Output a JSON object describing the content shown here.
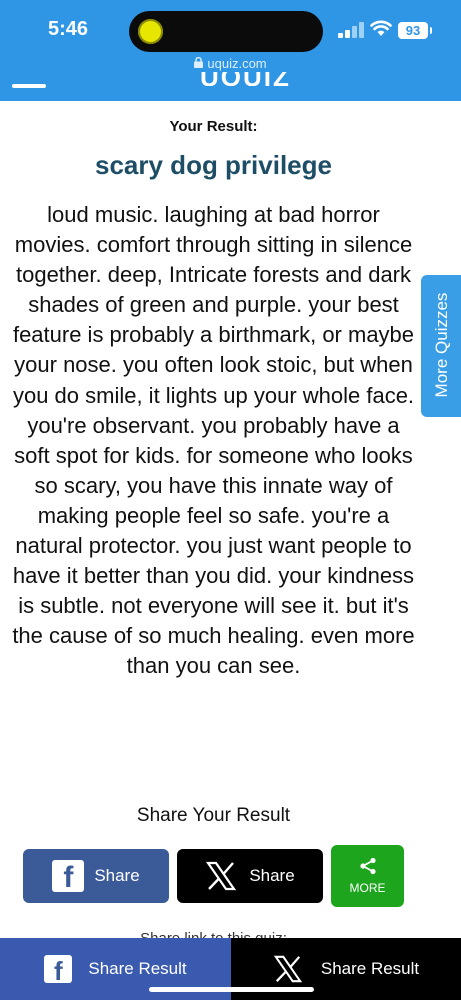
{
  "status_bar": {
    "time": "5:46",
    "battery": "93",
    "icons": [
      "signal-icon",
      "wifi-icon",
      "battery-icon"
    ]
  },
  "browser": {
    "url": "uquiz.com",
    "logo_text": "UQUIZ"
  },
  "result": {
    "label": "Your Result:",
    "title": "scary dog privilege",
    "body": "loud music. laughing at bad horror movies. comfort through sitting in silence together. deep, Intricate forests and dark shades of green and purple. your best feature is probably a birthmark, or maybe your nose. you often look stoic, but when you do smile, it lights up your whole face. you're observant. you probably have a soft spot for kids. for someone who looks so scary, you have this innate way of making people feel so safe. you're a natural protector. you just want people to have it better than you did. your kindness is subtle. not everyone will see it. but it's the cause of so much healing. even more than you can see."
  },
  "side_tab": {
    "label": "More Quizzes"
  },
  "share": {
    "heading": "Share Your Result",
    "facebook_label": "Share",
    "x_label": "Share",
    "more_label": "MORE",
    "link_heading": "Share link to this quiz:"
  },
  "bottom_bar": {
    "facebook_label": "Share Result",
    "x_label": "Share Result"
  },
  "colors": {
    "header_blue": "#2f96e6",
    "title_color": "#1e4e66",
    "facebook_blue": "#3a5a98",
    "more_green": "#1ea51e"
  }
}
